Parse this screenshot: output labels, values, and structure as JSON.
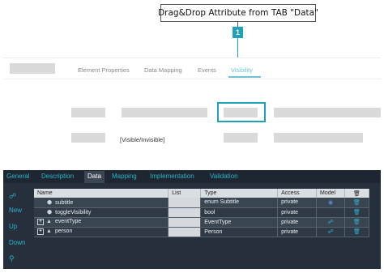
{
  "callout": {
    "text": "Drag&Drop Attribute from TAB \"Data\"",
    "number": "1"
  },
  "properties_panel": {
    "tabs": [
      {
        "label": "Element Properties",
        "active": false
      },
      {
        "label": "Data Mapping",
        "active": false
      },
      {
        "label": "Events",
        "active": false
      },
      {
        "label": "Visibility",
        "active": true
      }
    ],
    "visible_field": "[Visible/Invisible]"
  },
  "editor": {
    "tabs": [
      {
        "label": "General",
        "active": false
      },
      {
        "label": "Description",
        "active": false
      },
      {
        "label": "Data",
        "active": true
      },
      {
        "label": "Mapping",
        "active": false
      },
      {
        "label": "Implementation",
        "active": false
      },
      {
        "label": "Validation",
        "active": false
      }
    ],
    "sidebar": [
      {
        "label": "New",
        "icon": "link-icon"
      },
      {
        "label": "Up"
      },
      {
        "label": "Down"
      },
      {
        "icon": "search-icon"
      }
    ],
    "columns": [
      "Name",
      "List",
      "Type",
      "Access",
      "Model",
      "delete"
    ],
    "rows": [
      {
        "name": "subtitle",
        "list": "",
        "type": "enum Subtitle",
        "access": "private",
        "model_icon": "globe-icon",
        "expandable": false,
        "icon": "cube-icon"
      },
      {
        "name": "toggleVisibility",
        "list": "",
        "type": "bool",
        "access": "private",
        "model_icon": "",
        "expandable": false,
        "icon": "cube-icon"
      },
      {
        "name": "eventType",
        "list": "",
        "type": "EventType",
        "access": "private",
        "model_icon": "link-icon",
        "expandable": true,
        "icon": "cubes-icon"
      },
      {
        "name": "person",
        "list": "",
        "type": "Person",
        "access": "private",
        "model_icon": "link-icon",
        "expandable": true,
        "icon": "cubes-icon"
      }
    ]
  },
  "colors": {
    "accent": "#2bb3c8",
    "dark_bg": "#26303c",
    "header_bg": "#d9dee3"
  }
}
